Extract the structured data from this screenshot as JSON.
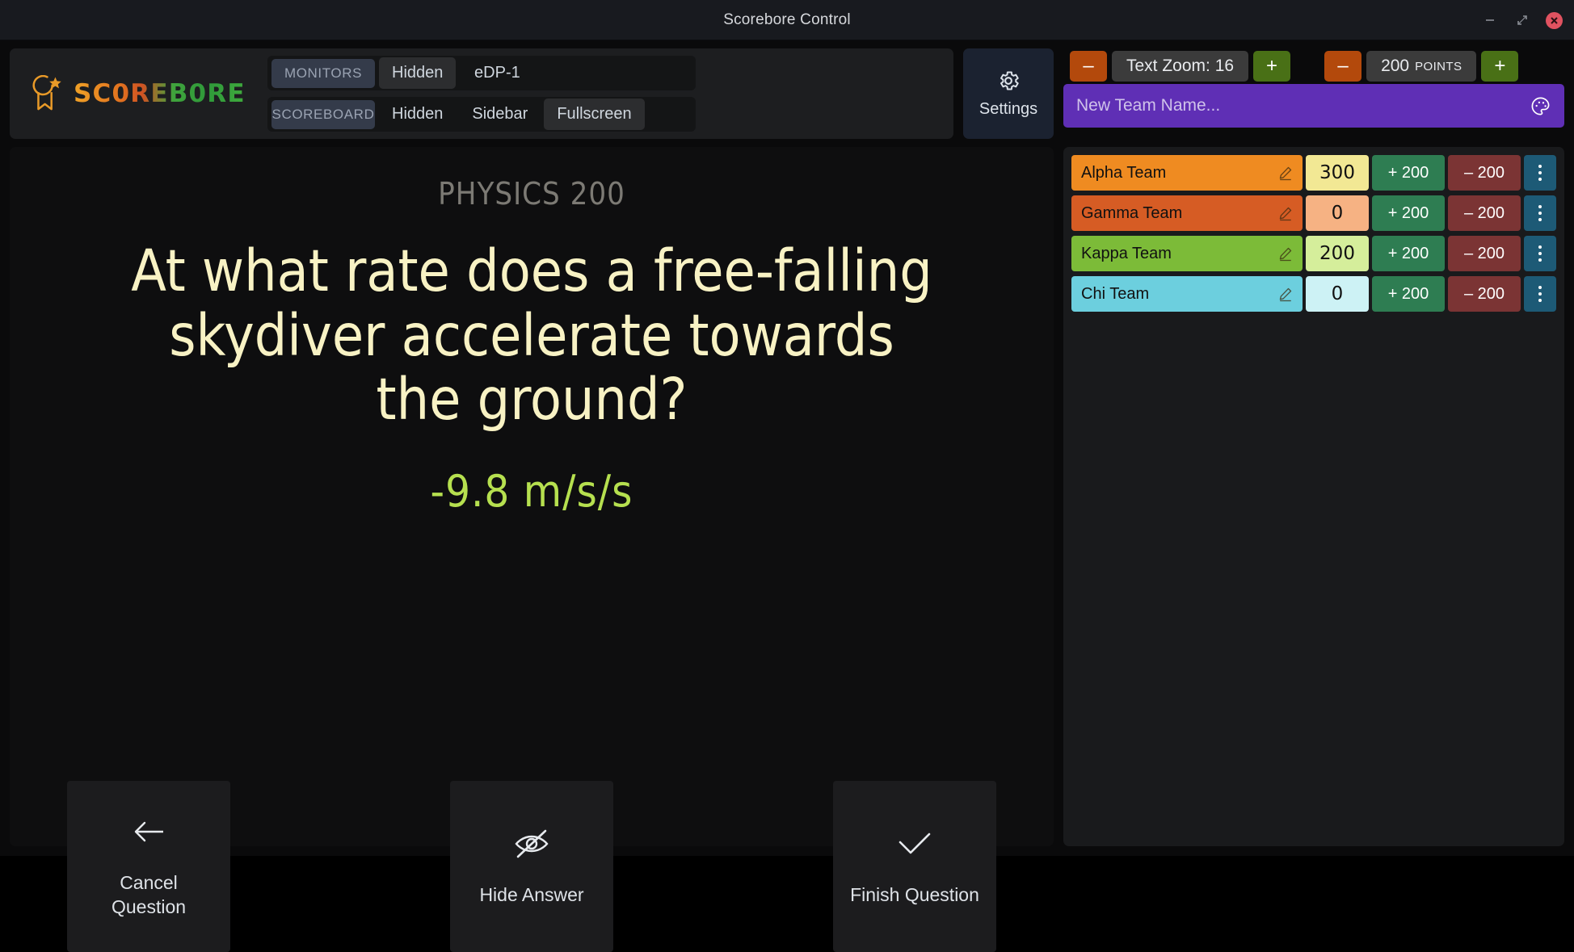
{
  "window": {
    "title": "Scorebore Control",
    "minimize_label": "–",
    "maximize_label": "⤢",
    "close_label": "✕"
  },
  "brand": {
    "name": "SC0REB0RE",
    "icon": "award-medal-star-icon"
  },
  "monitors": {
    "rows": [
      {
        "tag": "MONITORS",
        "options": [
          {
            "label": "Hidden",
            "selected": true
          },
          {
            "label": "eDP-1",
            "selected": false
          }
        ]
      },
      {
        "tag": "SCOREBOARD",
        "options": [
          {
            "label": "Hidden",
            "selected": false
          },
          {
            "label": "Sidebar",
            "selected": false
          },
          {
            "label": "Fullscreen",
            "selected": true
          }
        ]
      }
    ]
  },
  "settings": {
    "label": "Settings",
    "icon": "gear-icon"
  },
  "right_toolbar": {
    "text_zoom": {
      "minus": "–",
      "value": "Text Zoom: 16",
      "plus": "+"
    },
    "points": {
      "minus": "–",
      "value": "200",
      "units": "POINTS",
      "plus": "+"
    }
  },
  "new_team": {
    "placeholder": "New Team Name...",
    "palette_icon": "palette-icon",
    "add_label": "+"
  },
  "teams": [
    {
      "name": "Alpha Team",
      "score": "300",
      "plus": "+ 200",
      "minus": "– 200",
      "color": "#ef8b21",
      "score_color": "#f2e894"
    },
    {
      "name": "Gamma Team",
      "score": "0",
      "plus": "+ 200",
      "minus": "– 200",
      "color": "#d65c24",
      "score_color": "#f6b283"
    },
    {
      "name": "Kappa Team",
      "score": "200",
      "plus": "+ 200",
      "minus": "– 200",
      "color": "#7cbb38",
      "score_color": "#d5ee9b"
    },
    {
      "name": "Chi Team",
      "score": "0",
      "plus": "+ 200",
      "minus": "– 200",
      "color": "#6ccfde",
      "score_color": "#cdf2f5"
    }
  ],
  "stage": {
    "category": "PHYSICS 200",
    "question": "At what rate does a free-falling skydiver accelerate towards the ground?",
    "answer": "-9.8 m/s/s",
    "actions": [
      {
        "label": "Cancel\nQuestion",
        "icon": "arrow-left-icon"
      },
      {
        "label": "Hide Answer",
        "icon": "eye-off-icon"
      },
      {
        "label": "Finish Question",
        "icon": "check-icon"
      }
    ]
  },
  "colors": {
    "brand_orange": "#e58a24",
    "brand_green": "#3faa3d",
    "accent_purple": "#5f2fb5",
    "question_text": "#f8f2c4",
    "answer_text": "#b6e04f"
  }
}
